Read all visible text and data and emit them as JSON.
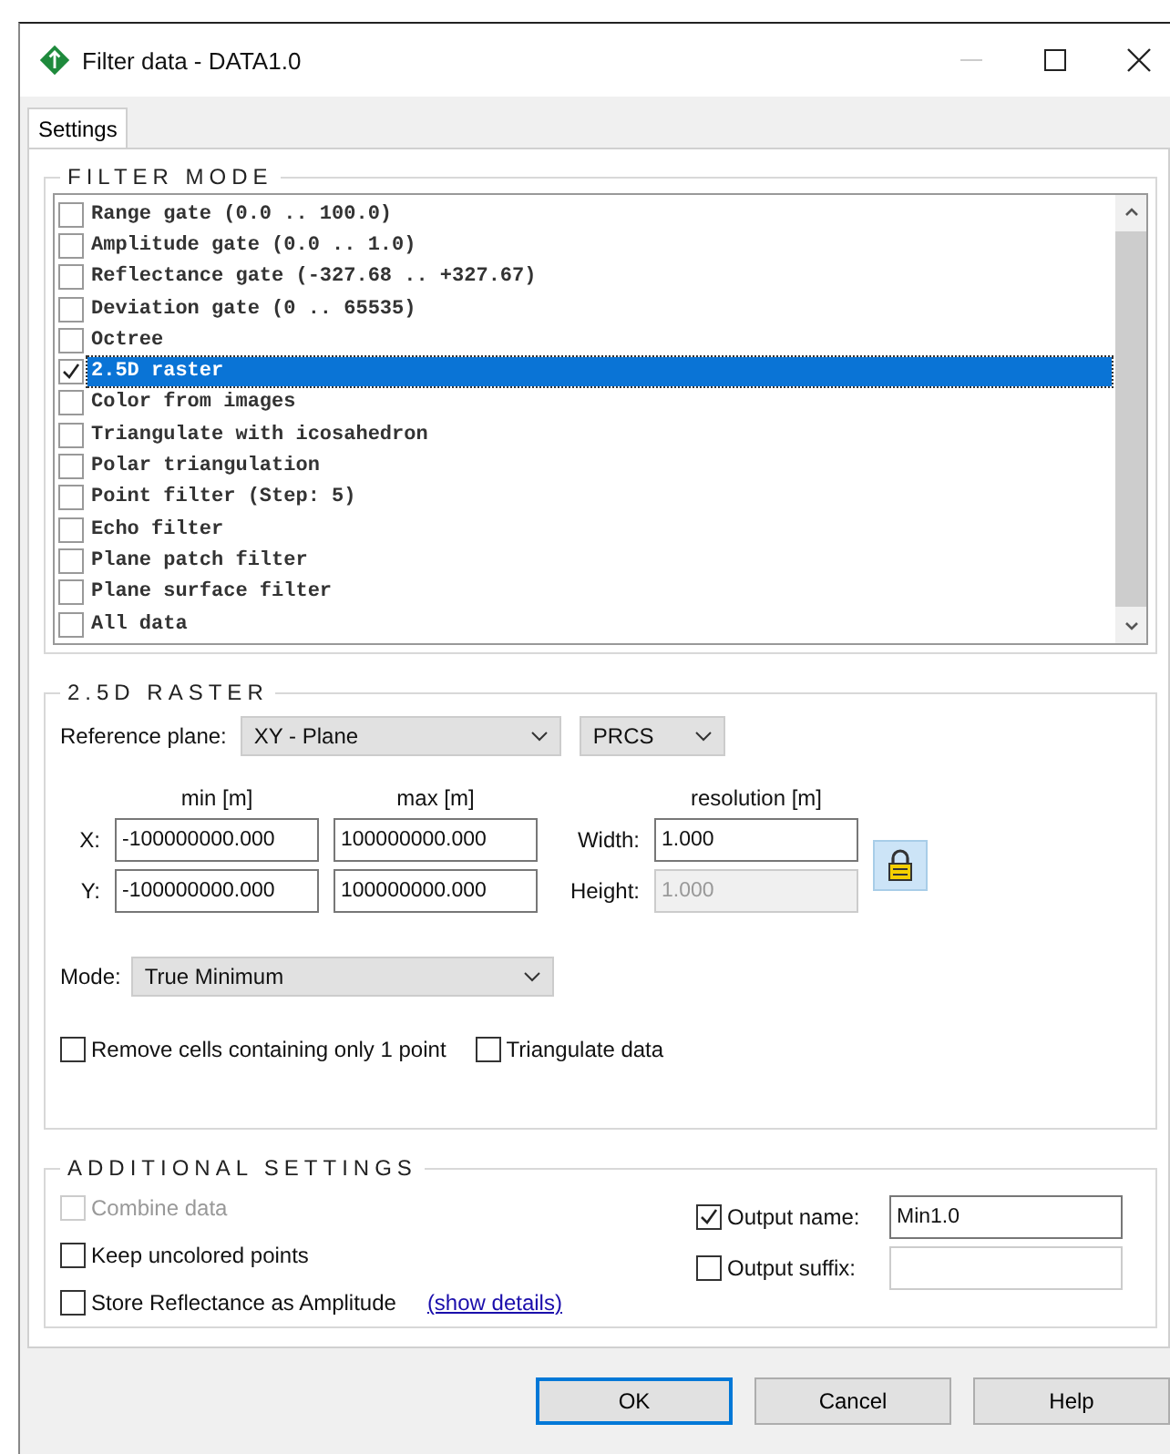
{
  "window": {
    "title": "Filter data - DATA1.0"
  },
  "tabs": [
    {
      "label": "Settings",
      "selected": true
    }
  ],
  "filter_mode": {
    "title": "FILTER MODE",
    "items": [
      {
        "label": "Range gate (0.0 .. 100.0)",
        "checked": false,
        "selected": false
      },
      {
        "label": "Amplitude gate (0.0 .. 1.0)",
        "checked": false,
        "selected": false
      },
      {
        "label": "Reflectance gate (-327.68 .. +327.67)",
        "checked": false,
        "selected": false
      },
      {
        "label": "Deviation gate (0 .. 65535)",
        "checked": false,
        "selected": false
      },
      {
        "label": "Octree",
        "checked": false,
        "selected": false
      },
      {
        "label": "2.5D raster",
        "checked": true,
        "selected": true
      },
      {
        "label": "Color from images",
        "checked": false,
        "selected": false
      },
      {
        "label": "Triangulate with icosahedron",
        "checked": false,
        "selected": false
      },
      {
        "label": "Polar triangulation",
        "checked": false,
        "selected": false
      },
      {
        "label": "Point filter (Step: 5)",
        "checked": false,
        "selected": false
      },
      {
        "label": "Echo filter",
        "checked": false,
        "selected": false
      },
      {
        "label": "Plane patch filter",
        "checked": false,
        "selected": false
      },
      {
        "label": "Plane surface filter",
        "checked": false,
        "selected": false
      },
      {
        "label": "All data",
        "checked": false,
        "selected": false
      }
    ]
  },
  "raster": {
    "title": "2.5D RASTER",
    "reference_plane_label": "Reference plane:",
    "reference_plane": "XY - Plane",
    "coordinate_system": "PRCS",
    "columns": [
      "min [m]",
      "max [m]",
      "resolution [m]"
    ],
    "rows": [
      {
        "axis": "X:",
        "min": "-100000000.000",
        "max": "100000000.000",
        "resolution_label": "Width:",
        "resolution": "1.000",
        "disabled": false
      },
      {
        "axis": "Y:",
        "min": "-100000000.000",
        "max": "100000000.000",
        "resolution_label": "Height:",
        "resolution": "1.000",
        "disabled": true
      }
    ],
    "mode_label": "Mode:",
    "mode": "True Minimum",
    "options": [
      {
        "label": "Remove cells containing only 1 point",
        "checked": false
      },
      {
        "label": "Triangulate data",
        "checked": false
      }
    ]
  },
  "additional": {
    "title": "ADDITIONAL SETTINGS",
    "left": [
      {
        "label": "Combine data",
        "checked": false,
        "disabled": true
      },
      {
        "label": "Keep uncolored points",
        "checked": false,
        "disabled": false
      },
      {
        "label": "Store Reflectance as Amplitude",
        "checked": false,
        "disabled": false
      }
    ],
    "link": "(show details)",
    "right": [
      {
        "label": "Output name:",
        "checked": true,
        "value": "Min1.0"
      },
      {
        "label": "Output suffix:",
        "checked": false
      }
    ]
  },
  "buttons": [
    {
      "label": "OK",
      "default": true
    },
    {
      "label": "Cancel",
      "default": false
    },
    {
      "label": "Help",
      "default": false
    }
  ]
}
